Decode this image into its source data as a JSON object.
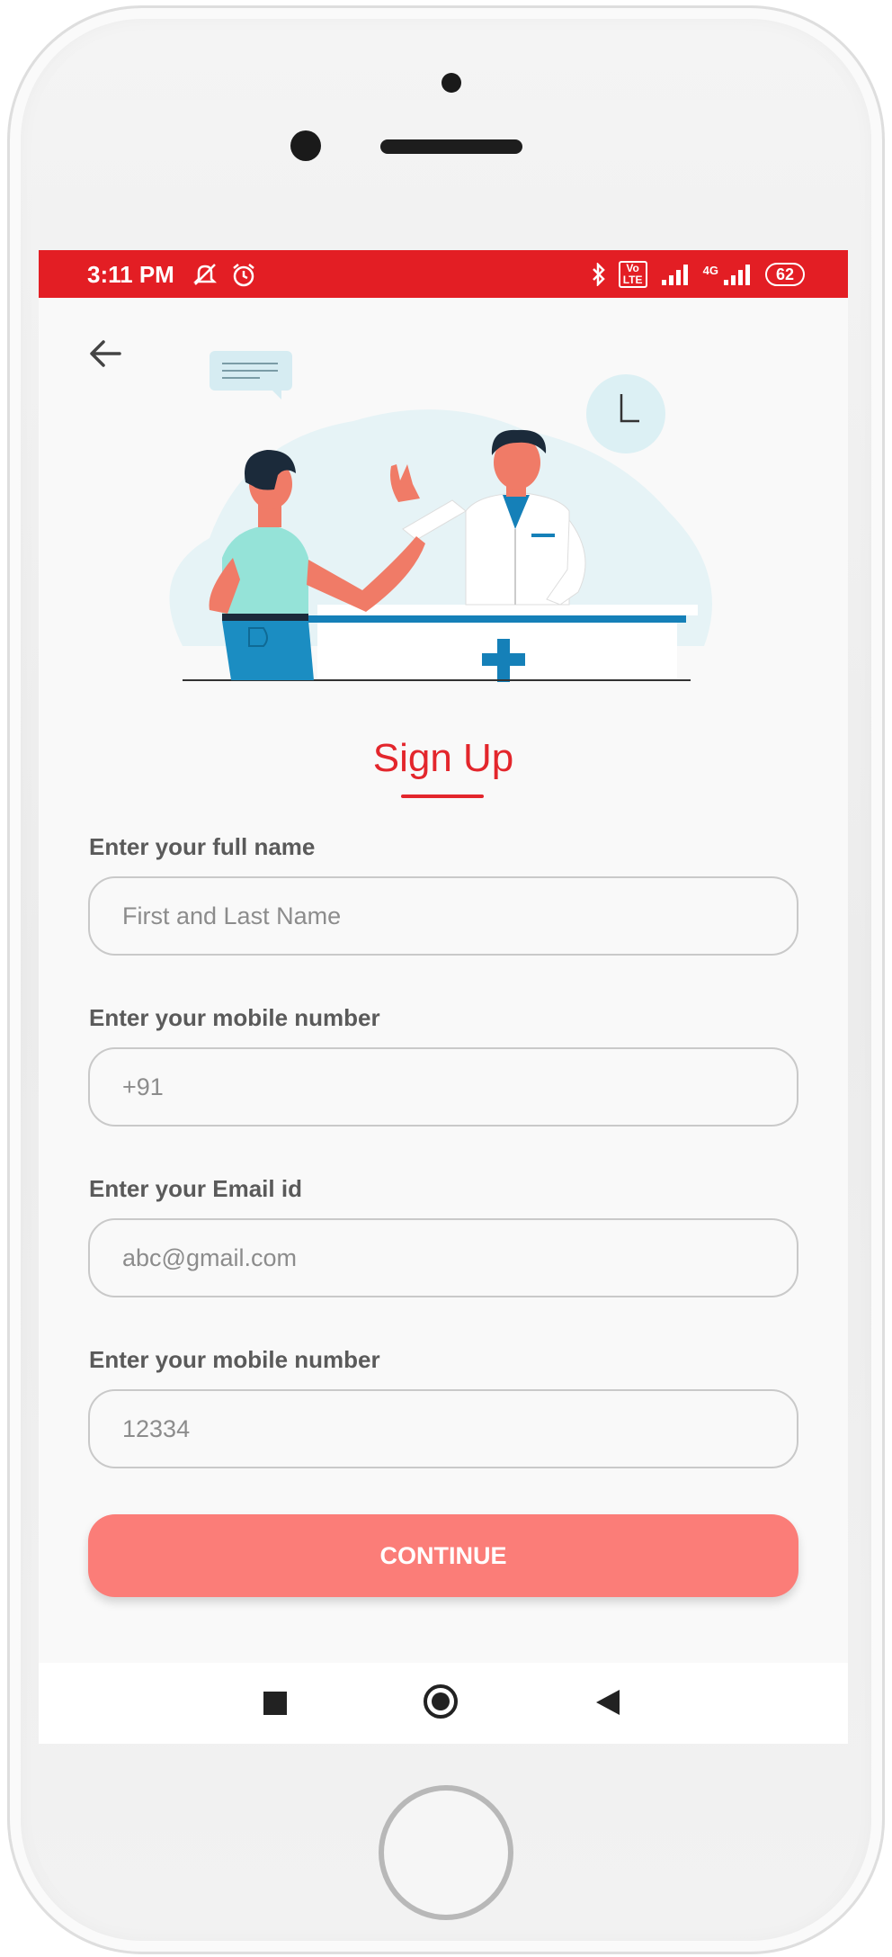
{
  "status_bar": {
    "time": "3:11 PM",
    "icons_left": [
      "silent-icon",
      "alarm-icon"
    ],
    "icons_right": [
      "bluetooth-icon",
      "volte-icon",
      "signal-icon",
      "4g-signal-icon"
    ],
    "volte_label": "Vo LTE",
    "network_label": "4G",
    "battery": "62"
  },
  "header": {
    "back_icon": "arrow-left-icon"
  },
  "illustration": {
    "description_icon": "doctor-patient-illustration"
  },
  "form": {
    "title": "Sign Up",
    "fields": [
      {
        "label": "Enter your full name",
        "placeholder": "First and Last Name"
      },
      {
        "label": "Enter your mobile number",
        "placeholder": "+91"
      },
      {
        "label": "Enter your Email id",
        "placeholder": "abc@gmail.com"
      },
      {
        "label": "Enter your mobile number",
        "placeholder": "12334"
      }
    ],
    "submit_label": "CONTINUE"
  },
  "nav_bar": {
    "icons": [
      "recents-icon",
      "home-icon",
      "back-icon"
    ]
  },
  "colors": {
    "accent": "#e31e24",
    "button": "#fb7d78",
    "illustration_blue": "#1580b8"
  }
}
